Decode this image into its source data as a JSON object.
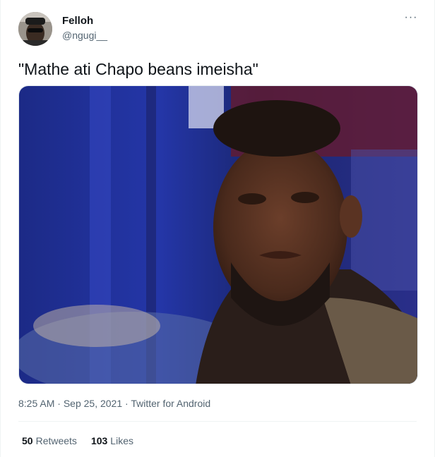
{
  "user": {
    "display_name": "Felloh",
    "handle": "@ngugi__"
  },
  "menu": {
    "more_label": "···"
  },
  "tweet": {
    "text": "\"Mathe ati Chapo beans imeisha\""
  },
  "meta": {
    "time": "8:25 AM",
    "separator_1": "·",
    "date": "Sep 25, 2021",
    "separator_2": "·",
    "source": "Twitter for Android"
  },
  "stats": {
    "retweets_count": "50",
    "retweets_label": "Retweets",
    "likes_count": "103",
    "likes_label": "Likes"
  },
  "colors": {
    "muted_text": "#536471",
    "primary_text": "#0f1419",
    "divider": "#eff3f4"
  },
  "icons": {
    "more": "more-horizontal-icon"
  }
}
